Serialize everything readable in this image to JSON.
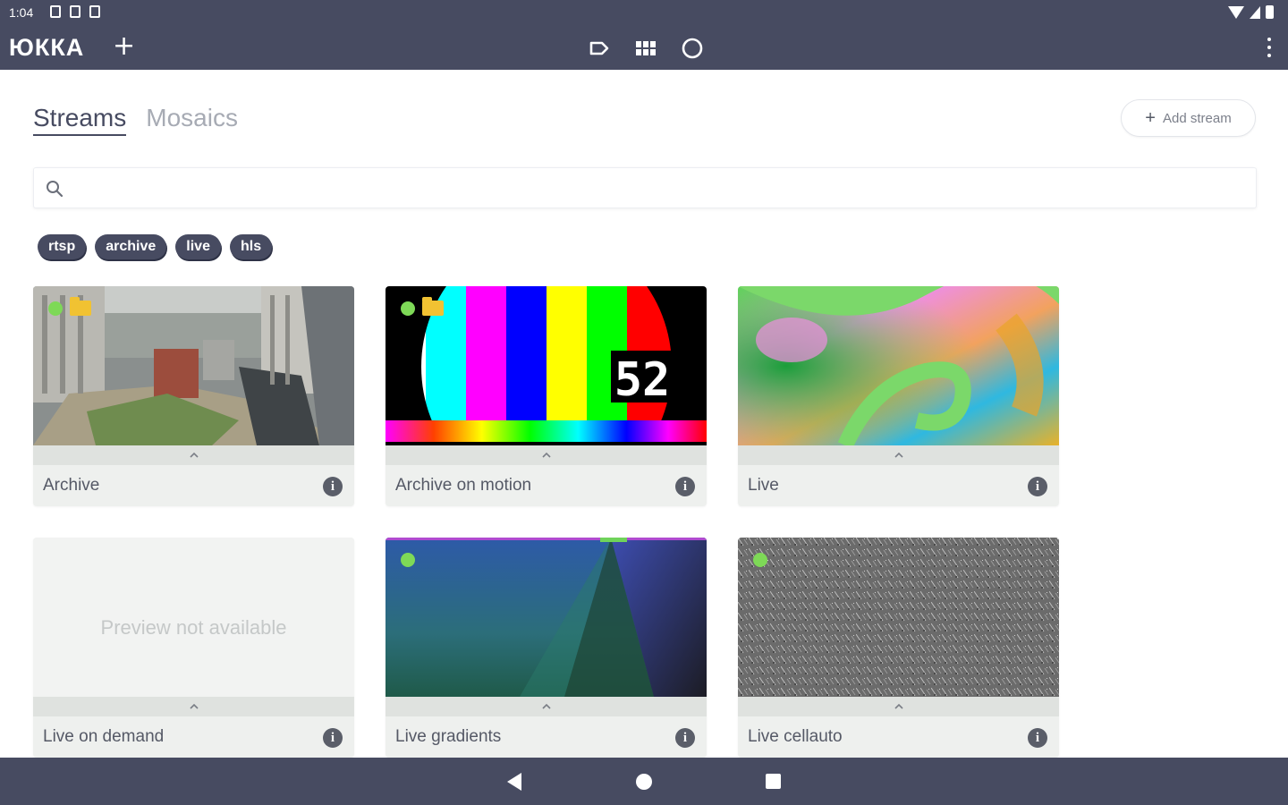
{
  "status_bar": {
    "time": "1:04"
  },
  "app_bar": {
    "logo": "ЮККА",
    "add_icon": "plus-icon",
    "center_icons": [
      "tag-icon",
      "grid-icon",
      "circle-icon"
    ],
    "menu_icon": "more-vert-icon"
  },
  "tabs": [
    {
      "label": "Streams",
      "active": true
    },
    {
      "label": "Mosaics",
      "active": false
    }
  ],
  "add_stream_button": {
    "icon": "+",
    "label": "Add stream"
  },
  "search": {
    "placeholder": "",
    "value": ""
  },
  "tags": [
    "rtsp",
    "archive",
    "live",
    "hls"
  ],
  "cards": [
    {
      "title": "Archive",
      "live_indicator": true,
      "archive_indicator": true,
      "preview": "aerial-city-courtyard"
    },
    {
      "title": "Archive on motion",
      "live_indicator": true,
      "archive_indicator": true,
      "preview": "color-bars-test-pattern"
    },
    {
      "title": "Live",
      "live_indicator": false,
      "archive_indicator": false,
      "preview": "mandelbrot-fractal"
    },
    {
      "title": "Live on demand",
      "live_indicator": false,
      "archive_indicator": false,
      "preview_text": "Preview not available"
    },
    {
      "title": "Live gradients",
      "live_indicator": true,
      "archive_indicator": false,
      "preview": "conic-gradient"
    },
    {
      "title": "Live cellauto",
      "live_indicator": true,
      "archive_indicator": false,
      "preview": "gray-noise"
    }
  ],
  "test_pattern_counter": "52",
  "info_glyph": "i",
  "colors": {
    "primary": "#474b61",
    "live_dot": "#7ed957",
    "archive_folder": "#f1c232",
    "card_bg": "#eef0ee"
  }
}
